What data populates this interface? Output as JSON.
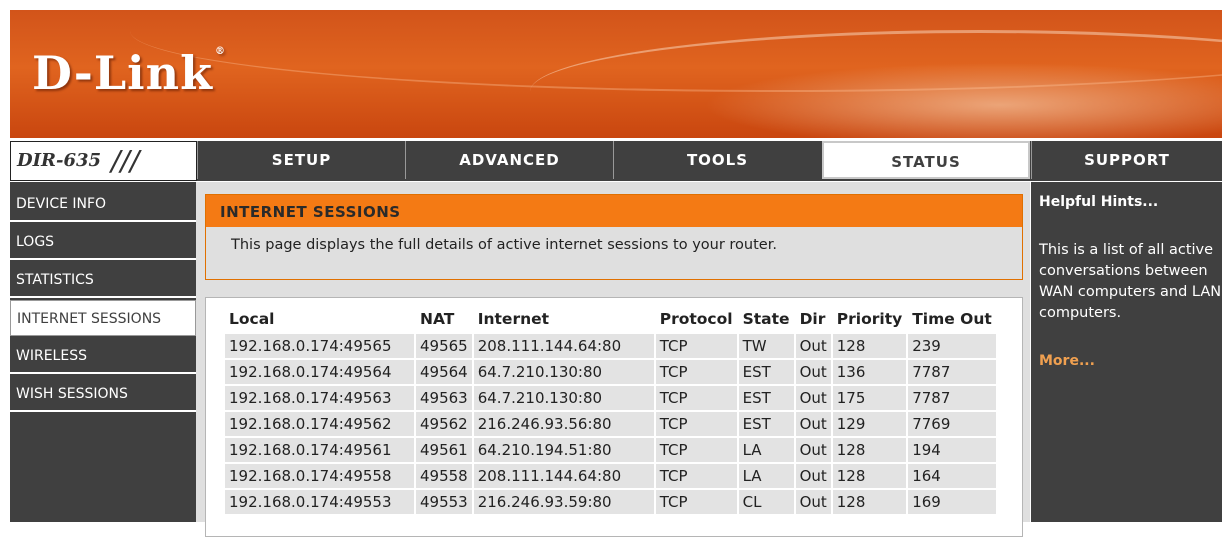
{
  "header": {
    "logo_text": "D-Link",
    "registered_mark": "®"
  },
  "nav": {
    "model": "DIR-635",
    "model_slashes": "///",
    "tabs": [
      {
        "label": "SETUP",
        "active": false
      },
      {
        "label": "ADVANCED",
        "active": false
      },
      {
        "label": "TOOLS",
        "active": false
      },
      {
        "label": "STATUS",
        "active": true
      },
      {
        "label": "SUPPORT",
        "active": false
      }
    ]
  },
  "sidebar": {
    "items": [
      {
        "label": "DEVICE INFO",
        "active": false
      },
      {
        "label": "LOGS",
        "active": false
      },
      {
        "label": "STATISTICS",
        "active": false
      },
      {
        "label": "INTERNET SESSIONS",
        "active": true
      },
      {
        "label": "WIRELESS",
        "active": false
      },
      {
        "label": "WISH SESSIONS",
        "active": false
      }
    ]
  },
  "main": {
    "section_title": "INTERNET SESSIONS",
    "description": "This page displays the full details of active internet sessions to your router.",
    "table": {
      "headers": [
        "Local",
        "NAT",
        "Internet",
        "Protocol",
        "State",
        "Dir",
        "Priority",
        "Time Out"
      ],
      "rows": [
        [
          "192.168.0.174:49565",
          "49565",
          "208.111.144.64:80",
          "TCP",
          "TW",
          "Out",
          "128",
          "239"
        ],
        [
          "192.168.0.174:49564",
          "49564",
          "64.7.210.130:80",
          "TCP",
          "EST",
          "Out",
          "136",
          "7787"
        ],
        [
          "192.168.0.174:49563",
          "49563",
          "64.7.210.130:80",
          "TCP",
          "EST",
          "Out",
          "175",
          "7787"
        ],
        [
          "192.168.0.174:49562",
          "49562",
          "216.246.93.56:80",
          "TCP",
          "EST",
          "Out",
          "129",
          "7769"
        ],
        [
          "192.168.0.174:49561",
          "49561",
          "64.210.194.51:80",
          "TCP",
          "LA",
          "Out",
          "128",
          "194"
        ],
        [
          "192.168.0.174:49558",
          "49558",
          "208.111.144.64:80",
          "TCP",
          "LA",
          "Out",
          "128",
          "164"
        ],
        [
          "192.168.0.174:49553",
          "49553",
          "216.246.93.59:80",
          "TCP",
          "CL",
          "Out",
          "128",
          "169"
        ]
      ]
    }
  },
  "hints": {
    "title": "Helpful Hints...",
    "body": "This is a list of all active conversations between WAN computers and LAN computers.",
    "more": "More..."
  },
  "colors": {
    "banner_orange": "#d2541a",
    "nav_dark": "#404040",
    "section_orange": "#f47a14",
    "more_link": "#f0a050"
  }
}
